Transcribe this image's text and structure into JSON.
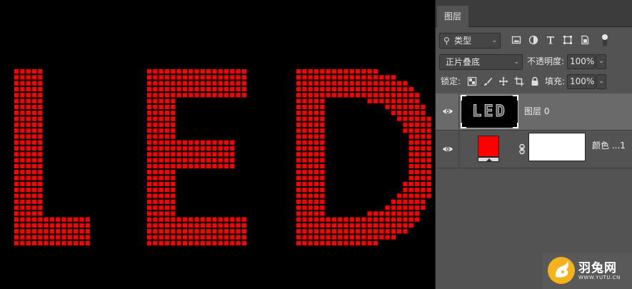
{
  "canvas": {
    "text": "LED",
    "text_color": "#ff0000",
    "background": "#000000"
  },
  "panel": {
    "tab_label": "图层",
    "filter": {
      "value": "类型",
      "icons": [
        "image-filter-icon",
        "adjustment-filter-icon",
        "type-filter-icon",
        "shape-filter-icon",
        "smart-object-filter-icon"
      ]
    },
    "blend_mode": "正片叠底",
    "opacity_label": "不透明度:",
    "opacity_value": "100%",
    "lock_label": "锁定:",
    "fill_label": "填充:",
    "fill_value": "100%",
    "layers": [
      {
        "name": "图层 0",
        "thumb_text": "LED",
        "visible": true,
        "selected": true
      },
      {
        "name": "颜色 ...1",
        "fill_color": "#ff0000",
        "mask_color": "#ffffff",
        "visible": true,
        "selected": false
      }
    ]
  },
  "watermark": {
    "title": "羽兔网",
    "url": "WWW.YUTU.CN"
  }
}
